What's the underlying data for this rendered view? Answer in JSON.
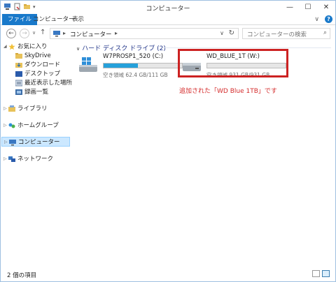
{
  "window": {
    "title": "コンピューター"
  },
  "titlebar": {
    "minimize": "—",
    "maximize": "☐",
    "close": "✕"
  },
  "ribbon": {
    "tabs": [
      {
        "label": "ファイル"
      },
      {
        "label": "コンピューター"
      },
      {
        "label": "表示"
      }
    ],
    "collapse": "∨",
    "help": "?"
  },
  "address": {
    "back": "←",
    "forward": "→",
    "recent": "∨",
    "up": "↑",
    "crumb": "コンピューター",
    "separator": "▸",
    "dropdown": "∨",
    "refresh": "↻"
  },
  "search": {
    "placeholder": "コンピューターの検索",
    "icon": "⌕"
  },
  "nav": {
    "favorites": {
      "label": "お気に入り",
      "icon": "star-icon"
    },
    "favorite_items": [
      {
        "label": "SkyDrive",
        "icon": "folder-icon"
      },
      {
        "label": "ダウンロード",
        "icon": "download-icon"
      },
      {
        "label": "デスクトップ",
        "icon": "desktop-icon"
      },
      {
        "label": "最近表示した場所",
        "icon": "recent-icon"
      },
      {
        "label": "録画一覧",
        "icon": "recordings-icon"
      }
    ],
    "libraries": {
      "label": "ライブラリ"
    },
    "homegroup": {
      "label": "ホームグループ"
    },
    "computer": {
      "label": "コンピューター"
    },
    "network": {
      "label": "ネットワーク"
    },
    "expand_glyph": "▷",
    "collapse_glyph": "◢"
  },
  "main": {
    "group_header": "ハード ディスク ドライブ (2)",
    "group_chevron": "∨",
    "drives": [
      {
        "name": "W7PROSP1_520 (C:)",
        "free": "空き領域 62.4 GB/111 GB",
        "used_fraction": 0.44
      },
      {
        "name": "WD_BLUE_1T (W:)",
        "free": "空き領域 931 GB/931 GB",
        "used_fraction": 0.0
      }
    ],
    "annotation": "追加された「WD Blue 1TB」です"
  },
  "status": {
    "count": "2 個の項目"
  },
  "colors": {
    "accent": "#1979ca",
    "bar_fill": "#26a0da",
    "highlight": "#cc2222",
    "selection": "#cce8ff"
  }
}
